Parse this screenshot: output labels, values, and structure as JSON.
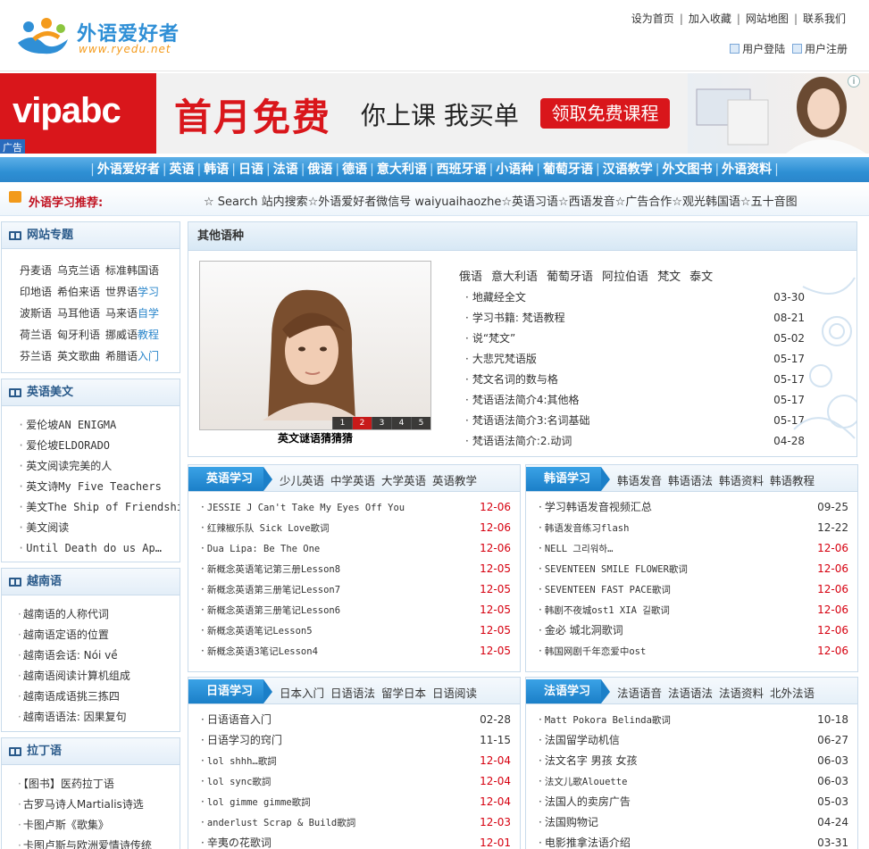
{
  "site": {
    "name_cn": "外语爱好者",
    "url_text": "www.ryedu.net"
  },
  "toplinks": [
    "设为首页",
    "加入收藏",
    "网站地图",
    "联系我们"
  ],
  "userlinks": [
    "用户登陆",
    "用户注册"
  ],
  "ad": {
    "brand": "vipabc",
    "headline": "首月免费",
    "sub": "你上课 我买单",
    "button": "领取免费课程",
    "tag": "广告",
    "info": "i"
  },
  "nav": [
    "外语爱好者",
    "英语",
    "韩语",
    "日语",
    "法语",
    "俄语",
    "德语",
    "意大利语",
    "西班牙语",
    "小语种",
    "葡萄牙语",
    "汉语教学",
    "外文图书",
    "外语资料"
  ],
  "recommend": {
    "label": "外语学习推荐:",
    "items": [
      "☆ Search 站内搜索",
      "☆外语爱好者微信号 waiyuaihaozhe",
      "☆英语习语",
      "☆西语发音",
      "☆广告合作",
      "☆观光韩国语",
      "☆五十音图"
    ]
  },
  "topics": {
    "title": "网站专题",
    "rows": [
      [
        {
          "t": "丹麦语"
        },
        {
          "t": "乌克兰语"
        },
        {
          "t": "标准韩国语"
        }
      ],
      [
        {
          "t": "印地语"
        },
        {
          "t": "希伯来语"
        },
        {
          "t": "世界语",
          "h": "学习"
        }
      ],
      [
        {
          "t": "波斯语"
        },
        {
          "t": "马耳他语"
        },
        {
          "t": "马来语",
          "h": "自学"
        }
      ],
      [
        {
          "t": "荷兰语"
        },
        {
          "t": "匈牙利语"
        },
        {
          "t": "挪威语",
          "h": "教程"
        }
      ],
      [
        {
          "t": "芬兰语"
        },
        {
          "t": "英文歌曲"
        },
        {
          "t": "希腊语",
          "h": "入门"
        }
      ]
    ]
  },
  "english_beauty": {
    "title": "英语美文",
    "items": [
      "爱伦坡AN ENIGMA",
      "爱伦坡ELDORADO",
      "英文阅读完美的人",
      "英文诗My Five Teachers",
      "美文The Ship of Friendship",
      "美文阅读",
      "Until Death do us Ap…"
    ]
  },
  "vietnamese": {
    "title": "越南语",
    "items": [
      "越南语的人称代词",
      "越南语定语的位置",
      "越南语会话: Nói về",
      "越南语阅读计算机组成",
      "越南语成语挑三拣四",
      "越南语语法: 因果复句"
    ]
  },
  "latin": {
    "title": "拉丁语",
    "items": [
      "【图书】医药拉丁语",
      "古罗马诗人Martialis诗选",
      "卡图卢斯《歌集》",
      "卡图卢斯与欧洲爱情诗传统"
    ]
  },
  "other": {
    "title": "其他语种",
    "caption": "英文谜语猜猜猜",
    "pager": [
      "1",
      "2",
      "3",
      "4",
      "5"
    ],
    "pager_active": 2,
    "langs": [
      "俄语",
      "意大利语",
      "葡萄牙语",
      "阿拉伯语",
      "梵文",
      "泰文"
    ],
    "items": [
      {
        "t": "地藏经全文",
        "d": "03-30"
      },
      {
        "t": "学习书籍: 梵语教程",
        "d": "08-21"
      },
      {
        "t": "说“梵文”",
        "d": "05-02"
      },
      {
        "t": "大悲咒梵语版",
        "d": "05-17"
      },
      {
        "t": "梵文名词的数与格",
        "d": "05-17"
      },
      {
        "t": "梵语语法简介4:其他格",
        "d": "05-17"
      },
      {
        "t": "梵语语法简介3:名词基础",
        "d": "05-17"
      },
      {
        "t": "梵语语法简介:2.动词",
        "d": "04-28"
      }
    ]
  },
  "english": {
    "tab": "英语学习",
    "subs": [
      "少儿英语",
      "中学英语",
      "大学英语",
      "英语教学"
    ],
    "items": [
      {
        "t": "JESSIE J Can't Take My Eyes Off You",
        "d": "12-06",
        "r": true,
        "m": true
      },
      {
        "t": "红辣椒乐队 Sick Love歌词",
        "d": "12-06",
        "r": true
      },
      {
        "t": "Dua Lipa: Be The One",
        "d": "12-06",
        "r": true,
        "m": true
      },
      {
        "t": "新概念英语笔记第三册Lesson8",
        "d": "12-05",
        "r": true
      },
      {
        "t": "新概念英语第三册笔记Lesson7",
        "d": "12-05",
        "r": true
      },
      {
        "t": "新概念英语第三册笔记Lesson6",
        "d": "12-05",
        "r": true
      },
      {
        "t": "新概念英语笔记Lesson5",
        "d": "12-05",
        "r": true
      },
      {
        "t": "新概念英语3笔记Lesson4",
        "d": "12-05",
        "r": true
      }
    ]
  },
  "korean": {
    "tab": "韩语学习",
    "subs": [
      "韩语发音",
      "韩语语法",
      "韩语资料",
      "韩语教程"
    ],
    "items": [
      {
        "t": "学习韩语发音视频汇总",
        "d": "09-25",
        "r": false
      },
      {
        "t": "韩语发音练习flash",
        "d": "12-22",
        "r": false
      },
      {
        "t": "NELL 그리워하…",
        "d": "12-06",
        "r": true
      },
      {
        "t": "SEVENTEEN SMILE FLOWER歌词",
        "d": "12-06",
        "r": true
      },
      {
        "t": "SEVENTEEN FAST PACE歌词",
        "d": "12-06",
        "r": true
      },
      {
        "t": "韩剧不夜城ost1 XIA 길歌词",
        "d": "12-06",
        "r": true
      },
      {
        "t": "金必 城北洞歌词",
        "d": "12-06",
        "r": true
      },
      {
        "t": "韩国网剧千年恋爱中ost",
        "d": "12-06",
        "r": true
      }
    ]
  },
  "japanese": {
    "tab": "日语学习",
    "subs": [
      "日本入门",
      "日语语法",
      "留学日本",
      "日语阅读"
    ],
    "items": [
      {
        "t": "日语语音入门",
        "d": "02-28",
        "r": false
      },
      {
        "t": "日语学习的窍门",
        "d": "11-15",
        "r": false
      },
      {
        "t": "lol shhh…歌詞",
        "d": "12-04",
        "r": true
      },
      {
        "t": "lol sync歌詞",
        "d": "12-04",
        "r": true
      },
      {
        "t": "lol gimme gimme歌詞",
        "d": "12-04",
        "r": true
      },
      {
        "t": "anderlust Scrap & Build歌詞",
        "d": "12-03",
        "r": true
      },
      {
        "t": "辛夷の花歌词",
        "d": "12-01",
        "r": true
      }
    ]
  },
  "french": {
    "tab": "法语学习",
    "subs": [
      "法语语音",
      "法语语法",
      "法语资料",
      "北外法语"
    ],
    "items": [
      {
        "t": "Matt Pokora Belinda歌词",
        "d": "10-18",
        "r": false
      },
      {
        "t": "法国留学动机信",
        "d": "06-27",
        "r": false
      },
      {
        "t": "法文名字 男孩 女孩",
        "d": "06-03",
        "r": false
      },
      {
        "t": "法文儿歌Alouette",
        "d": "06-03",
        "r": false
      },
      {
        "t": "法国人的卖房广告",
        "d": "05-03",
        "r": false
      },
      {
        "t": "法国购物记",
        "d": "04-24",
        "r": false
      },
      {
        "t": "电影推拿法语介绍",
        "d": "03-31",
        "r": false
      }
    ]
  },
  "colors": {
    "nav_blue": "#2e8fd4",
    "accent_red": "#c0101f",
    "date_red": "#d6000f"
  }
}
